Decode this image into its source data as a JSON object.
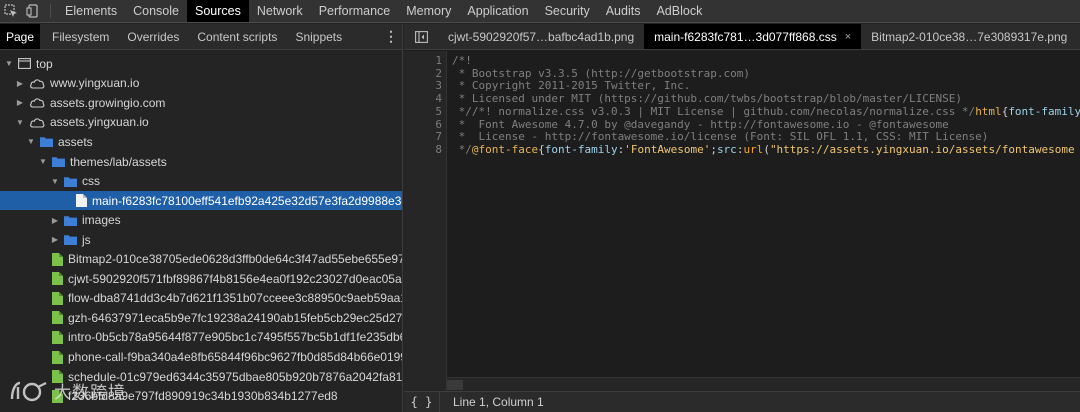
{
  "toolbar": {
    "tabs": [
      "Elements",
      "Console",
      "Sources",
      "Network",
      "Performance",
      "Memory",
      "Application",
      "Security",
      "Audits",
      "AdBlock"
    ],
    "active_tab": "Sources"
  },
  "navigator": {
    "tabs": [
      "Page",
      "Filesystem",
      "Overrides",
      "Content scripts",
      "Snippets"
    ],
    "active_tab": "Page",
    "tree": [
      {
        "label": "top",
        "icon": "frame-icon",
        "level": 0,
        "expanded": true
      },
      {
        "label": "www.yingxuan.io",
        "icon": "cloud-icon",
        "level": 1,
        "expanded": false
      },
      {
        "label": "assets.growingio.com",
        "icon": "cloud-icon",
        "level": 1,
        "expanded": false
      },
      {
        "label": "assets.yingxuan.io",
        "icon": "cloud-icon",
        "level": 1,
        "expanded": true
      },
      {
        "label": "assets",
        "icon": "folder-icon",
        "level": 2,
        "expanded": true
      },
      {
        "label": "themes/lab/assets",
        "icon": "folder-icon",
        "level": 3,
        "expanded": true
      },
      {
        "label": "css",
        "icon": "folder-icon",
        "level": 4,
        "expanded": true
      },
      {
        "label": "main-f6283fc78100eff541efb92a425e32d57e3fa2d9988e3e",
        "icon": "file-white-icon",
        "level": 5,
        "selected": true
      },
      {
        "label": "images",
        "icon": "folder-icon",
        "level": 4,
        "expanded": false
      },
      {
        "label": "js",
        "icon": "folder-icon",
        "level": 4,
        "expanded": false
      },
      {
        "label": "Bitmap2-010ce38705ede0628d3ffb0de64c3f47ad55ebe655e97",
        "icon": "file-green-icon",
        "level": 3
      },
      {
        "label": "cjwt-5902920f571fbf89867f4b8156e4ea0f192c23027d0eac05a2",
        "icon": "file-green-icon",
        "level": 3
      },
      {
        "label": "flow-dba8741dd3c4b7d621f1351b07cceee3c88950c9aeb59aa1",
        "icon": "file-green-icon",
        "level": 3
      },
      {
        "label": "gzh-64637971eca5b9e7fc19238a24190ab15feb5cb29ec25d27a",
        "icon": "file-green-icon",
        "level": 3
      },
      {
        "label": "intro-0b5cb78a95644f877e905bc1c7495f557bc5b1df1fe235db6",
        "icon": "file-green-icon",
        "level": 3
      },
      {
        "label": "phone-call-f9ba340a4e8fb65844f96bc9627fb0d85d84b66e0199",
        "icon": "file-green-icon",
        "level": 3
      },
      {
        "label": "schedule-01c979ed6344c35975dbae805b920b7876a2042fa81a",
        "icon": "file-green-icon",
        "level": 3
      },
      {
        "label": "f236bfd8a9e797fd890919c34b1930b834b1277ed8",
        "icon": "file-green-icon",
        "level": 3
      }
    ]
  },
  "editor": {
    "tabs": [
      {
        "label": "cjwt-5902920f57…bafbc4ad1b.png",
        "active": false,
        "closable": false
      },
      {
        "label": "main-f6283fc781…3d077ff868.css",
        "active": true,
        "closable": true
      },
      {
        "label": "Bitmap2-010ce38…7e3089317e.png",
        "active": false,
        "closable": false
      }
    ],
    "line_numbers": [
      "1",
      "2",
      "3",
      "4",
      "5",
      "6",
      "7",
      "8"
    ],
    "code": [
      [
        {
          "t": "/*!",
          "c": "cm"
        }
      ],
      [
        {
          "t": " * Bootstrap v3.3.5 (http://getbootstrap.com)",
          "c": "cm"
        }
      ],
      [
        {
          "t": " * Copyright 2011-2015 Twitter, Inc.",
          "c": "cm"
        }
      ],
      [
        {
          "t": " * Licensed under MIT (https://github.com/twbs/bootstrap/blob/master/LICENSE)",
          "c": "cm"
        }
      ],
      [
        {
          "t": " *//*! normalize.css v3.0.3 | MIT License | github.com/necolas/normalize.css */",
          "c": "cm"
        },
        {
          "t": "html",
          "c": "sel"
        },
        {
          "t": "{",
          "c": "punc"
        },
        {
          "t": "font-family",
          "c": "prop"
        }
      ],
      [
        {
          "t": " *  Font Awesome 4.7.0 by @davegandy - http://fontawesome.io - @fontawesome",
          "c": "cm"
        }
      ],
      [
        {
          "t": " *  License - http://fontawesome.io/license (Font: SIL OFL 1.1, CSS: MIT License)",
          "c": "cm"
        }
      ],
      [
        {
          "t": " */",
          "c": "cm"
        },
        {
          "t": "@font-face",
          "c": "sel"
        },
        {
          "t": "{",
          "c": "punc"
        },
        {
          "t": "font-family",
          "c": "prop"
        },
        {
          "t": ":",
          "c": "punc"
        },
        {
          "t": "'FontAwesome'",
          "c": "str"
        },
        {
          "t": ";",
          "c": "punc"
        },
        {
          "t": "src",
          "c": "prop"
        },
        {
          "t": ":",
          "c": "punc"
        },
        {
          "t": "url",
          "c": "fn"
        },
        {
          "t": "(",
          "c": "punc"
        },
        {
          "t": "\"https://assets.yingxuan.io/assets/fontawesome",
          "c": "str"
        }
      ]
    ],
    "status": {
      "format_label": "{ }",
      "position": "Line 1, Column 1"
    }
  },
  "watermark": {
    "text": "大数跨境"
  },
  "colors": {
    "selection": "#1f5fa8",
    "folder": "#3d7fd6",
    "file_green": "#7cc24a"
  }
}
